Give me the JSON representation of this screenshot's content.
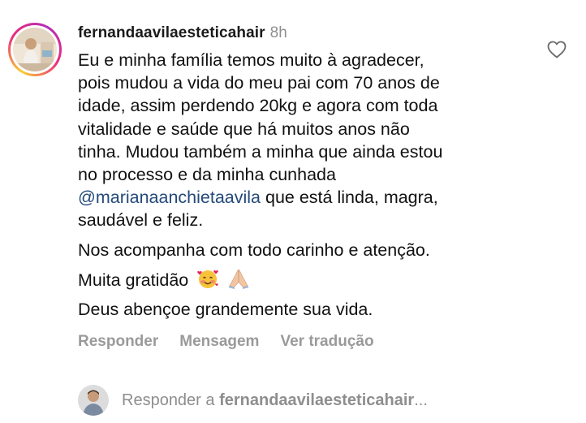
{
  "comment": {
    "username": "fernandaavilaesteticahair",
    "time": "8h",
    "paragraph1": [
      "Eu e minha família temos muito à agradecer,",
      "pois mudou a vida do meu pai com 70 anos de",
      "idade, assim perdendo 20kg e agora com toda",
      "vitalidade e saúde que há muitos anos não",
      "tinha. Mudou também a minha que ainda estou",
      "no processo e da minha cunhada"
    ],
    "mention": "@marianaanchietaavila",
    "mention_tail": " que está linda, magra,",
    "paragraph1_last": "saudável e feliz.",
    "paragraph2": "Nos acompanha com todo carinho e atenção.",
    "paragraph3": "Muita gratidão",
    "paragraph4": "Deus abençoe grandemente sua vida."
  },
  "actions": {
    "reply": "Responder",
    "message": "Mensagem",
    "translate": "Ver tradução"
  },
  "reply_bar": {
    "prefix": "Responder a ",
    "username": "fernandaavilaesteticahair",
    "ellipsis": "..."
  },
  "icons": {
    "like": "heart-outline-icon",
    "emoji1": "smiling-face-with-hearts-emoji",
    "emoji2": "folded-hands-emoji"
  },
  "colors": {
    "mention": "#23497a",
    "muted": "#8e8e8e",
    "text": "#111111"
  }
}
